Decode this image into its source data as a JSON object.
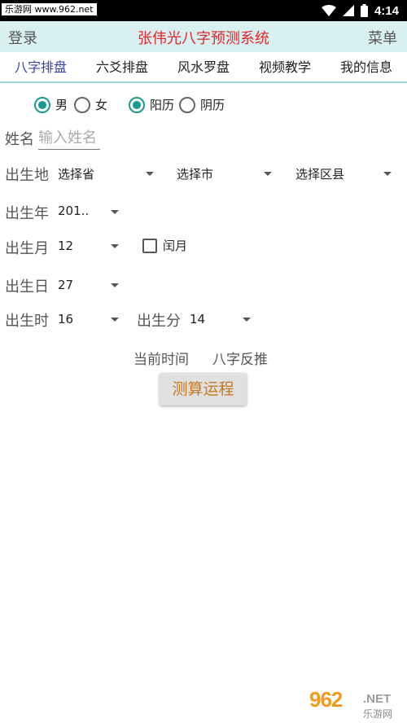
{
  "statusbar": {
    "watermark": "乐游网 www.962.net",
    "time": "4:14"
  },
  "header": {
    "login": "登录",
    "title": "张伟光八字预测系统",
    "menu": "菜单"
  },
  "tabs": [
    "八字排盘",
    "六爻排盘",
    "风水罗盘",
    "视频教学",
    "我的信息"
  ],
  "gender": {
    "male": "男",
    "female": "女",
    "selected": "男"
  },
  "calendar": {
    "solar": "阳历",
    "lunar": "阴历",
    "selected": "阳历"
  },
  "name": {
    "label": "姓名",
    "placeholder": "输入姓名"
  },
  "birthplace": {
    "label": "出生地",
    "province": "选择省",
    "city": "选择市",
    "district": "选择区县"
  },
  "year": {
    "label": "出生年",
    "value": "201.."
  },
  "month": {
    "label": "出生月",
    "value": "12",
    "leap_label": "闰月",
    "leap_checked": false
  },
  "day": {
    "label": "出生日",
    "value": "27"
  },
  "hour": {
    "label": "出生时",
    "value": "16"
  },
  "minute": {
    "label": "出生分",
    "value": "14"
  },
  "actions": {
    "current_time": "当前时间",
    "reverse": "八字反推",
    "calculate": "测算运程"
  },
  "badge": {
    "main": "962",
    "net": ".NET",
    "sub": "乐游网"
  }
}
